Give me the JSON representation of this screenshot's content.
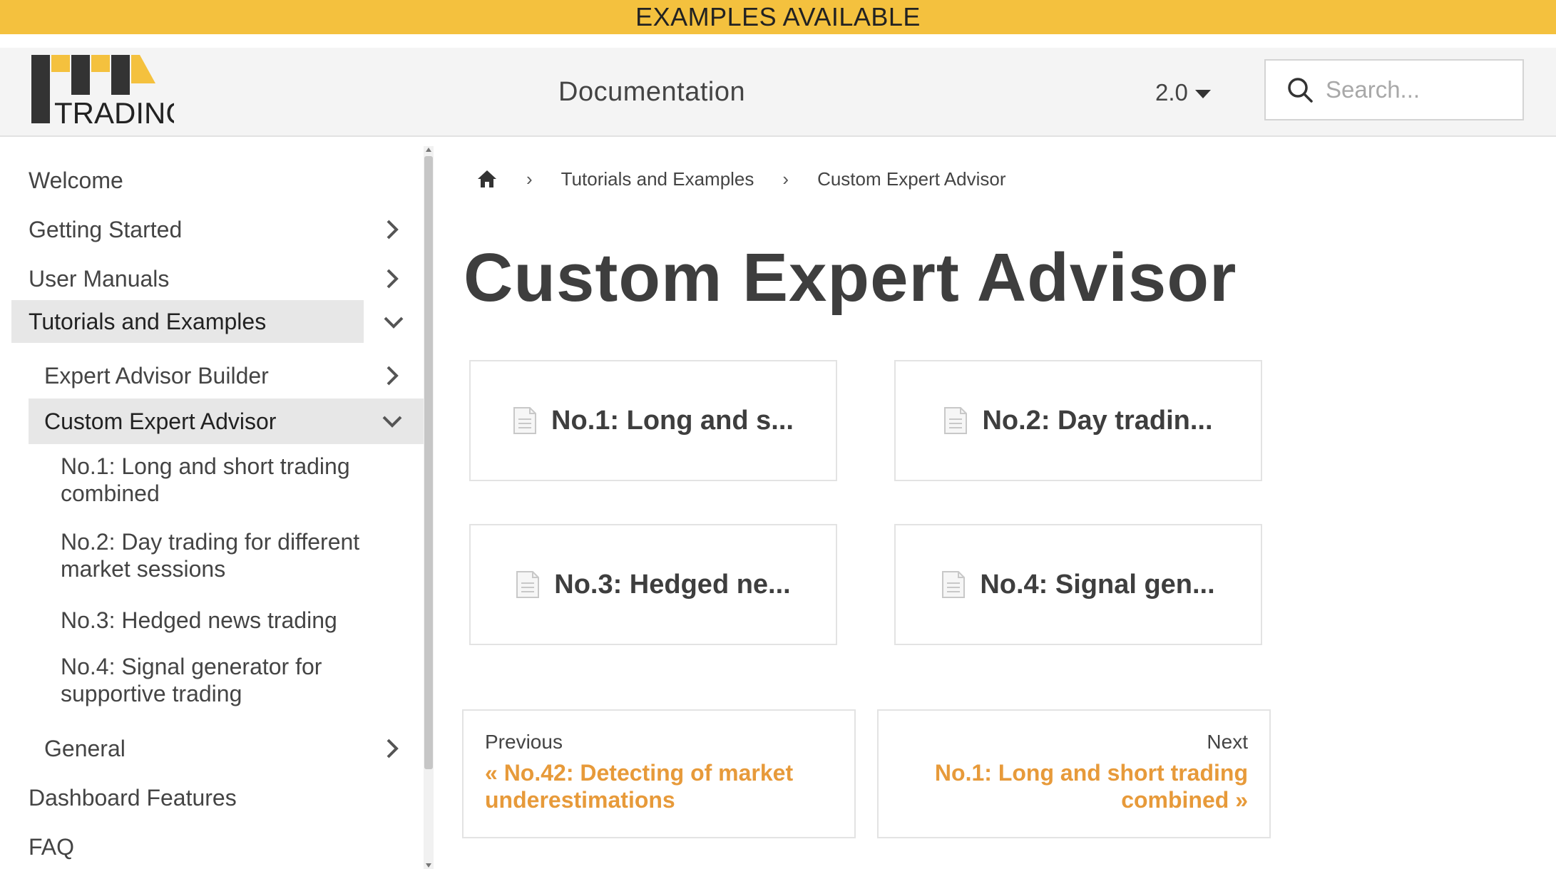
{
  "banner": {
    "text": "EXAMPLES AVAILABLE"
  },
  "header": {
    "logo_text": "TRADING",
    "title": "Documentation",
    "version": "2.0",
    "search_placeholder": "Search..."
  },
  "sidebar": {
    "items": [
      {
        "label": "Welcome"
      },
      {
        "label": "Getting Started"
      },
      {
        "label": "User Manuals"
      },
      {
        "label": "Tutorials and Examples"
      },
      {
        "label": "Expert Advisor Builder"
      },
      {
        "label": "Custom Expert Advisor"
      },
      {
        "label": "No.1: Long and short trading combined"
      },
      {
        "label": "No.2: Day trading for different market sessions"
      },
      {
        "label": "No.3: Hedged news trading"
      },
      {
        "label": "No.4: Signal generator for supportive trading"
      },
      {
        "label": "General"
      },
      {
        "label": "Dashboard Features"
      },
      {
        "label": "FAQ"
      }
    ]
  },
  "breadcrumb": {
    "items": [
      "Tutorials and Examples",
      "Custom Expert Advisor"
    ],
    "separator": "›"
  },
  "main": {
    "title": "Custom Expert Advisor",
    "cards": [
      {
        "label": "No.1: Long and s..."
      },
      {
        "label": "No.2: Day tradin..."
      },
      {
        "label": "No.3: Hedged ne..."
      },
      {
        "label": "No.4: Signal gen..."
      }
    ]
  },
  "pager": {
    "prev_label": "Previous",
    "prev_title": "« No.42: Detecting of market underestimations",
    "next_label": "Next",
    "next_title": "No.1: Long and short trading combined »"
  },
  "colors": {
    "banner": "#f4c13e",
    "accent": "#e79a3a",
    "logo_dark": "#333333",
    "logo_yellow": "#f4c13e"
  },
  "icons": [
    "search-icon",
    "home-icon",
    "chevron-right-icon",
    "chevron-down-icon",
    "document-icon"
  ]
}
